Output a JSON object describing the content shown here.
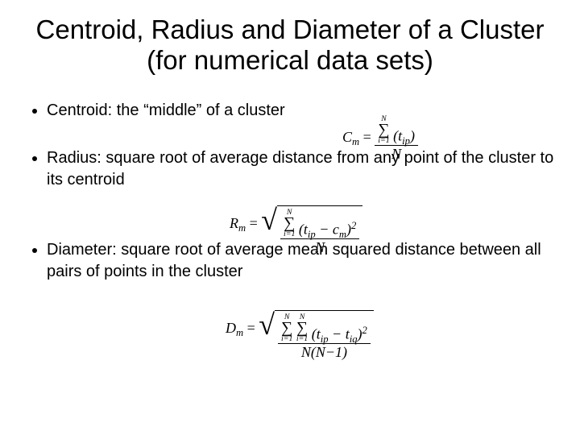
{
  "title": "Centroid, Radius and Diameter of a Cluster (for numerical data sets)",
  "bullets": {
    "b1": "Centroid:  the “middle” of a cluster",
    "b2": "Radius: square root of average distance from any point of the cluster to its centroid",
    "b3": "Diameter: square root of average mean squared distance between all pairs of points in the cluster"
  },
  "formulas": {
    "centroid": {
      "lhs_sym": "C",
      "lhs_sub": "m",
      "num_sigma_top": "N",
      "num_sigma_bot": "i=1",
      "num_rhs": "(t",
      "num_rhs_sub": "ip",
      "num_rhs2": ")",
      "den": "N"
    },
    "radius": {
      "lhs_sym": "R",
      "lhs_sub": "m",
      "sig_top": "N",
      "sig_bot": "i=1",
      "term": "(t",
      "term_sub1": "ip",
      "term2": " − c",
      "term_sub2": "m",
      "term3": ")",
      "exp": "2",
      "den": "N"
    },
    "diameter": {
      "lhs_sym": "D",
      "lhs_sub": "m",
      "sig1_top": "N",
      "sig1_bot": "i=1",
      "sig2_top": "N",
      "sig2_bot": "i=1",
      "term": "(t",
      "term_sub1": "ip",
      "term2": " − t",
      "term_sub2": "iq",
      "term3": ")",
      "exp": "2",
      "den": "N(N−1)"
    }
  }
}
